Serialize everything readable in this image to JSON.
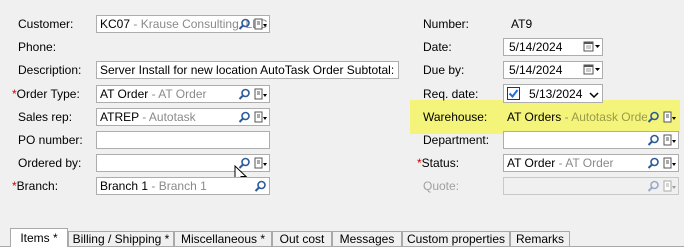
{
  "colors": {
    "required": "#cc0000",
    "highlight": "#f4f47a",
    "check": "#1e6fd9"
  },
  "left": {
    "customer": {
      "label": "Customer:",
      "code": "KC07",
      "desc": "Krause Consulting, LLC"
    },
    "phone": {
      "label": "Phone:"
    },
    "description": {
      "label": "Description:",
      "value": "Server Install for new location AutoTask Order Subtotal:"
    },
    "order_type": {
      "star": "*",
      "label": "Order Type:",
      "code": "AT Order",
      "desc": "AT Order"
    },
    "sales_rep": {
      "label": "Sales rep:",
      "code": "ATREP",
      "desc": "Autotask"
    },
    "po_number": {
      "label": "PO number:",
      "value": ""
    },
    "ordered_by": {
      "label": "Ordered by:",
      "value": ""
    },
    "branch": {
      "star": "*",
      "label": "Branch:",
      "code": "Branch 1",
      "desc": "Branch 1"
    }
  },
  "right": {
    "number": {
      "label": "Number:",
      "value": "AT9"
    },
    "date": {
      "label": "Date:",
      "value": "5/14/2024"
    },
    "due_by": {
      "label": "Due by:",
      "value": "5/14/2024"
    },
    "req_date": {
      "label": "Req. date:",
      "value": "5/13/2024",
      "checked": true
    },
    "warehouse": {
      "label": "Warehouse:",
      "code": "AT Orders",
      "desc": "Autotask Order"
    },
    "department": {
      "label": "Department:",
      "value": ""
    },
    "status": {
      "star": "*",
      "label": "Status:",
      "code": "AT Order",
      "desc": "AT Order"
    },
    "quote": {
      "label": "Quote:",
      "value": ""
    }
  },
  "separator": "-",
  "tabs": [
    {
      "label": "Items *",
      "active": true
    },
    {
      "label": "Billing / Shipping *"
    },
    {
      "label": "Miscellaneous *"
    },
    {
      "label": "Out cost"
    },
    {
      "label": "Messages"
    },
    {
      "label": "Custom properties"
    },
    {
      "label": "Remarks"
    }
  ],
  "icons": [
    "search-icon",
    "lookup-menu-icon",
    "calendar-icon",
    "checkbox-icon",
    "cursor-icon"
  ]
}
